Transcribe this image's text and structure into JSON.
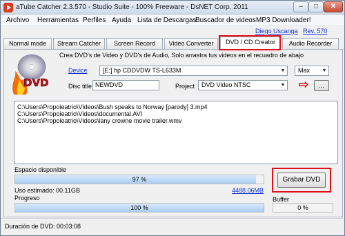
{
  "window": {
    "title": "aTube Catcher 2.3.570 - Studio Suite - 100% Freeware - DsNET Corp. 2011",
    "min_glyph": "–",
    "max_glyph": "□",
    "close_glyph": "✕"
  },
  "menu": {
    "items": [
      "Archivo",
      "Herramientas",
      "Perfiles",
      "Ayuda",
      "Lista de Descargas",
      "Buscador de videos",
      "MP3 Downloader!"
    ]
  },
  "topline": {
    "author": "Diego Uscanga",
    "revision": "Rev. 570"
  },
  "tabs": [
    "Normal mode",
    "Stream Catcher",
    "Screen Record",
    "Video Converter",
    "DVD / CD Creator",
    "Audio Recorder"
  ],
  "active_tab": "DVD / CD Creator",
  "panel": {
    "description": "Crea DVD's de Video y DVD's de Audio, Solo arrastra tus videos en el recuadro de abajo",
    "device_label": "Device",
    "device_value": "[E:] hp      CDDVDW TS-L633M",
    "speed_value": "Max",
    "disc_title_label": "Disc title",
    "disc_title_value": "NEWDVD",
    "project_label": "Project",
    "project_value": "DVD Video   NTSC",
    "more_button": "...",
    "arrow_glyph": "⇨",
    "files": [
      "C:\\Users\\Propoieatrio\\Videos\\Bush speaks to Norway [parody] 3.mp4",
      "C:\\Users\\Propoieatrio\\Videos\\documental.AVI",
      "C:\\Users\\Propoieatrio\\Videos\\lany crowne movie trailer.wmv"
    ],
    "space_label": "Espacio disponible",
    "space_percent_text": "97 %",
    "space_fraction": 0.97,
    "used_label": "Uso estimado: 00.11GB",
    "capacity_link": "4488.06MB",
    "burn_button": "Grabar DVD",
    "progress_label": "Progreso",
    "progress_percent_text": "100 %",
    "progress_fraction": 1.0,
    "buffer_label": "Buffer",
    "buffer_percent_text": "0 %",
    "buffer_fraction": 0.0
  },
  "status": {
    "duration": "Duración de DVD: 00:03:08"
  },
  "colors": {
    "highlight": "#e0101a",
    "link": "#0a2fd6",
    "progress": "#a9cdf4"
  }
}
